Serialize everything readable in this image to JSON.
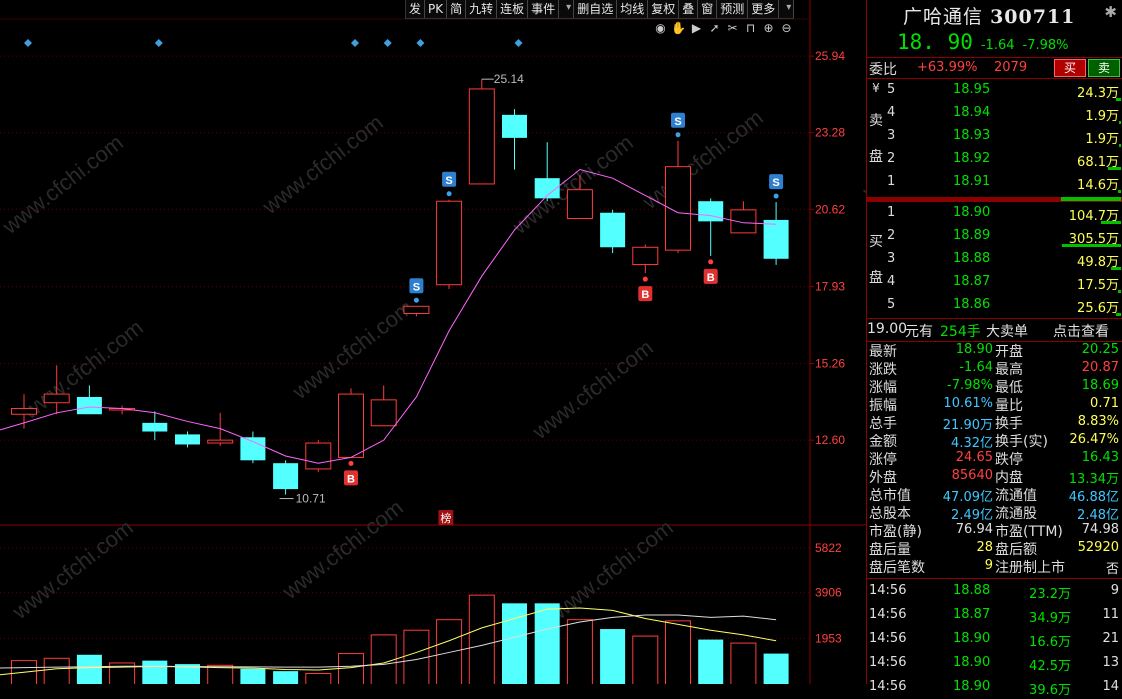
{
  "toolbar": {
    "items": [
      "发",
      "PK",
      "简",
      "九转",
      "连板",
      "事件",
      "",
      "删自选",
      "均线",
      "复权",
      "叠",
      "窗",
      "预测",
      "更多",
      ""
    ],
    "controls": [
      "eye-icon",
      "hand-icon",
      "play-icon",
      "cursor-icon",
      "scissors-icon",
      "lock-icon",
      "zoom-in-icon",
      "zoom-out-icon"
    ]
  },
  "chart": {
    "price_ticks": [
      "25.94",
      "23.28",
      "20.62",
      "17.93",
      "15.26",
      "12.60"
    ],
    "volume_ticks": [
      "5822",
      "3906",
      "1953"
    ],
    "high_label": "25.14",
    "low_label": "10.71",
    "bang_label": "榜",
    "s_label": "S",
    "b_label": "B",
    "watermark": "www.cfchi.com",
    "colors": {
      "up": "#ff3b3b",
      "down": "#54ffff",
      "ma": "#ff66ff",
      "vol_ma1": "#ffff66",
      "vol_ma2": "#dddddd",
      "grid": "#5a0000"
    }
  },
  "chart_data": {
    "type": "candlestick",
    "price_ylim": [
      10.0,
      26.5
    ],
    "volume_ylim": [
      0,
      6500
    ],
    "candles": [
      {
        "o": 13.5,
        "h": 14.2,
        "l": 13.0,
        "c": 13.7,
        "v": 1000
      },
      {
        "o": 13.9,
        "h": 15.2,
        "l": 13.5,
        "c": 14.2,
        "v": 1100
      },
      {
        "o": 14.1,
        "h": 14.5,
        "l": 13.6,
        "c": 13.5,
        "v": 1250
      },
      {
        "o": 13.7,
        "h": 13.8,
        "l": 13.5,
        "c": 13.7,
        "v": 900
      },
      {
        "o": 13.2,
        "h": 13.6,
        "l": 12.6,
        "c": 12.9,
        "v": 1000
      },
      {
        "o": 12.8,
        "h": 12.9,
        "l": 12.35,
        "c": 12.45,
        "v": 850
      },
      {
        "o": 12.5,
        "h": 13.55,
        "l": 12.4,
        "c": 12.6,
        "v": 800
      },
      {
        "o": 12.7,
        "h": 12.9,
        "l": 11.8,
        "c": 11.9,
        "v": 650
      },
      {
        "o": 11.8,
        "h": 11.9,
        "l": 10.71,
        "c": 10.9,
        "v": 550
      },
      {
        "o": 11.6,
        "h": 12.6,
        "l": 11.5,
        "c": 12.5,
        "v": 450
      },
      {
        "o": 12.0,
        "h": 14.4,
        "l": 12.0,
        "c": 14.2,
        "v": 1300
      },
      {
        "o": 13.1,
        "h": 14.5,
        "l": 13.1,
        "c": 14.0,
        "v": 2100
      },
      {
        "o": 17.0,
        "h": 17.25,
        "l": 16.9,
        "c": 17.25,
        "v": 2300
      },
      {
        "o": 18.0,
        "h": 20.95,
        "l": 17.85,
        "c": 20.9,
        "v": 2750
      },
      {
        "o": 21.5,
        "h": 25.14,
        "l": 21.5,
        "c": 24.8,
        "v": 3800
      },
      {
        "o": 23.9,
        "h": 24.1,
        "l": 22.0,
        "c": 23.1,
        "v": 3450
      },
      {
        "o": 21.7,
        "h": 22.95,
        "l": 20.9,
        "c": 21.0,
        "v": 3450
      },
      {
        "o": 20.3,
        "h": 21.8,
        "l": 20.3,
        "c": 21.3,
        "v": 2750
      },
      {
        "o": 20.5,
        "h": 20.6,
        "l": 19.1,
        "c": 19.3,
        "v": 2350
      },
      {
        "o": 18.7,
        "h": 19.4,
        "l": 18.4,
        "c": 19.3,
        "v": 2050
      },
      {
        "o": 19.2,
        "h": 23.0,
        "l": 19.1,
        "c": 22.1,
        "v": 2700
      },
      {
        "o": 20.9,
        "h": 21.0,
        "l": 19.0,
        "c": 20.2,
        "v": 1900
      },
      {
        "o": 19.8,
        "h": 20.9,
        "l": 19.8,
        "c": 20.6,
        "v": 1750
      },
      {
        "o": 20.25,
        "h": 20.87,
        "l": 18.69,
        "c": 18.9,
        "v": 1300
      }
    ],
    "ma": [
      13.2,
      13.55,
      13.75,
      13.7,
      13.55,
      13.25,
      13.0,
      12.55,
      12.05,
      11.8,
      12.0,
      12.6,
      14.1,
      16.4,
      18.3,
      19.9,
      21.1,
      22.0,
      21.7,
      21.1,
      20.5,
      20.4,
      20.15,
      20.1
    ],
    "vol_ma1": [
      500,
      650,
      700,
      720,
      750,
      730,
      700,
      680,
      620,
      600,
      700,
      900,
      1350,
      1850,
      2400,
      2800,
      3200,
      3250,
      3150,
      2800,
      2550,
      2300,
      2100,
      1850
    ],
    "vol_ma2": [
      700,
      720,
      740,
      760,
      760,
      750,
      740,
      730,
      720,
      720,
      760,
      840,
      1050,
      1350,
      1650,
      2000,
      2350,
      2650,
      2850,
      2950,
      2950,
      2850,
      2900,
      2750
    ],
    "s_marks": [
      12,
      13,
      20,
      23
    ],
    "b_marks": [
      10,
      19,
      21
    ],
    "top_marks": [
      0,
      4,
      10,
      11,
      12,
      15
    ]
  },
  "quote": {
    "name": "广哈通信",
    "code": "300711",
    "price": "18. 90",
    "change": "-1.64",
    "change_pct": "-7.98%",
    "weibi_label": "委比",
    "weibi_pct": "+63.99%",
    "weibi_diff": "2079",
    "buy_btn": "买",
    "sell_btn": "卖",
    "sell_label": [
      "卖",
      "盘"
    ],
    "buy_label": [
      "买",
      "盘"
    ],
    "yen": "¥",
    "asks": [
      {
        "lv": "5",
        "price": "18.95",
        "vol": "24.3万"
      },
      {
        "lv": "4",
        "price": "18.94",
        "vol": "1.9万"
      },
      {
        "lv": "3",
        "price": "18.93",
        "vol": "1.9万"
      },
      {
        "lv": "2",
        "price": "18.92",
        "vol": "68.1万"
      },
      {
        "lv": "1",
        "price": "18.91",
        "vol": "14.6万"
      }
    ],
    "bids": [
      {
        "lv": "1",
        "price": "18.90",
        "vol": "104.7万"
      },
      {
        "lv": "2",
        "price": "18.89",
        "vol": "305.5万"
      },
      {
        "lv": "3",
        "price": "18.88",
        "vol": "49.8万"
      },
      {
        "lv": "4",
        "price": "18.87",
        "vol": "17.5万"
      },
      {
        "lv": "5",
        "price": "18.86",
        "vol": "25.6万"
      }
    ],
    "big_order": {
      "price": "19.00",
      "unit": "元有",
      "qty": "254手",
      "label": "大卖单",
      "link": "点击查看"
    },
    "stats": [
      {
        "a": "最新",
        "av": "18.90",
        "ac": "g",
        "b": "开盘",
        "bv": "20.25",
        "bc": "g"
      },
      {
        "a": "涨跌",
        "av": "-1.64",
        "ac": "g",
        "b": "最高",
        "bv": "20.87",
        "bc": "r"
      },
      {
        "a": "涨幅",
        "av": "-7.98%",
        "ac": "g",
        "b": "最低",
        "bv": "18.69",
        "bc": "g"
      },
      {
        "a": "振幅",
        "av": "10.61%",
        "ac": "c",
        "b": "量比",
        "bv": "0.71",
        "bc": "y"
      },
      {
        "a": "总手",
        "av": "21.90万",
        "ac": "c",
        "b": "换手",
        "bv": "8.83%",
        "bc": "y"
      },
      {
        "a": "金额",
        "av": "4.32亿",
        "ac": "c",
        "b": "换手(实)",
        "bv": "26.47%",
        "bc": "y"
      },
      {
        "a": "涨停",
        "av": "24.65",
        "ac": "r",
        "b": "跌停",
        "bv": "16.43",
        "bc": "g"
      },
      {
        "a": "外盘",
        "av": "85640",
        "ac": "r",
        "b": "内盘",
        "bv": "13.34万",
        "bc": "g"
      },
      {
        "a": "总市值",
        "av": "47.09亿",
        "ac": "c",
        "b": "流通值",
        "bv": "46.88亿",
        "bc": "c"
      },
      {
        "a": "总股本",
        "av": "2.49亿",
        "ac": "c",
        "b": "流通股",
        "bv": "2.48亿",
        "bc": "c"
      },
      {
        "a": "市盈(静)",
        "av": "76.94",
        "ac": "w",
        "b": "市盈(TTM)",
        "bv": "74.98",
        "bc": "w"
      },
      {
        "a": "盘后量",
        "av": "28",
        "ac": "y",
        "b": "盘后额",
        "bv": "52920",
        "bc": "y"
      },
      {
        "a": "盘后笔数",
        "av": "9",
        "ac": "y",
        "b": "注册制上市",
        "bv": "否",
        "bc": "w"
      }
    ],
    "ticks": [
      {
        "t": "14:56",
        "p": "18.88",
        "v": "23.2万",
        "n": "9"
      },
      {
        "t": "14:56",
        "p": "18.87",
        "v": "34.9万",
        "n": "11"
      },
      {
        "t": "14:56",
        "p": "18.90",
        "v": "16.6万",
        "n": "21"
      },
      {
        "t": "14:56",
        "p": "18.90",
        "v": "42.5万",
        "n": "13"
      },
      {
        "t": "14:56",
        "p": "18.90",
        "v": "39.6万",
        "n": "14"
      }
    ]
  }
}
